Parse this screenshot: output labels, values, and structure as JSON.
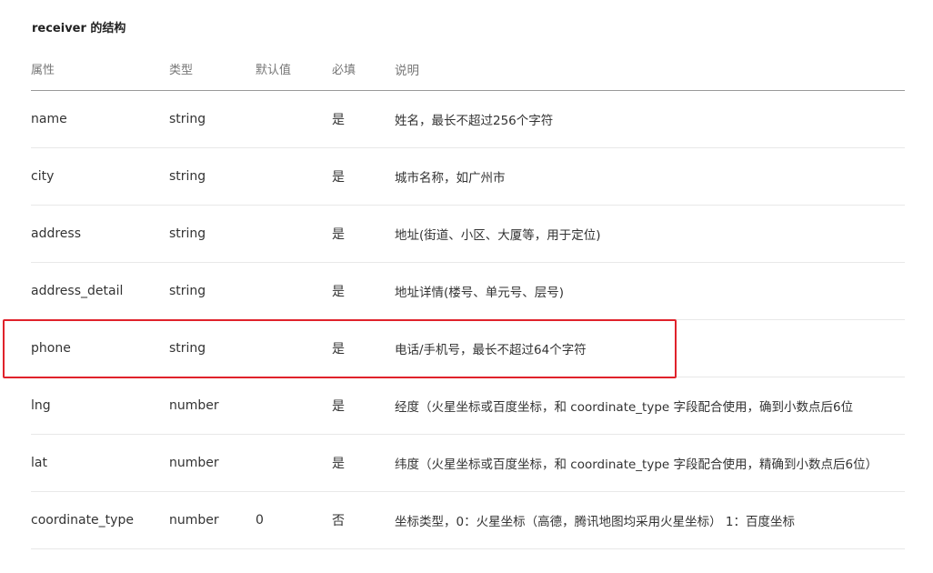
{
  "title": "receiver 的结构",
  "headers": {
    "attr": "属性",
    "type": "类型",
    "default": "默认值",
    "required": "必填",
    "desc": "说明"
  },
  "rows": [
    {
      "attr": "name",
      "type": "string",
      "default": "",
      "required": "是",
      "desc": "姓名，最长不超过256个字符"
    },
    {
      "attr": "city",
      "type": "string",
      "default": "",
      "required": "是",
      "desc": "城市名称，如广州市"
    },
    {
      "attr": "address",
      "type": "string",
      "default": "",
      "required": "是",
      "desc": "地址(街道、小区、大厦等，用于定位)"
    },
    {
      "attr": "address_detail",
      "type": "string",
      "default": "",
      "required": "是",
      "desc": "地址详情(楼号、单元号、层号)"
    },
    {
      "attr": "phone",
      "type": "string",
      "default": "",
      "required": "是",
      "desc": "电话/手机号，最长不超过64个字符"
    },
    {
      "attr": "lng",
      "type": "number",
      "default": "",
      "required": "是",
      "desc": "经度（火星坐标或百度坐标，和 coordinate_type 字段配合使用，确到小数点后6位"
    },
    {
      "attr": "lat",
      "type": "number",
      "default": "",
      "required": "是",
      "desc": "纬度（火星坐标或百度坐标，和 coordinate_type 字段配合使用，精确到小数点后6位）"
    },
    {
      "attr": "coordinate_type",
      "type": "number",
      "default": "0",
      "required": "否",
      "desc": "坐标类型，0：火星坐标（高德，腾讯地图均采用火星坐标） 1：百度坐标"
    }
  ],
  "highlight_color": "#e0222b"
}
